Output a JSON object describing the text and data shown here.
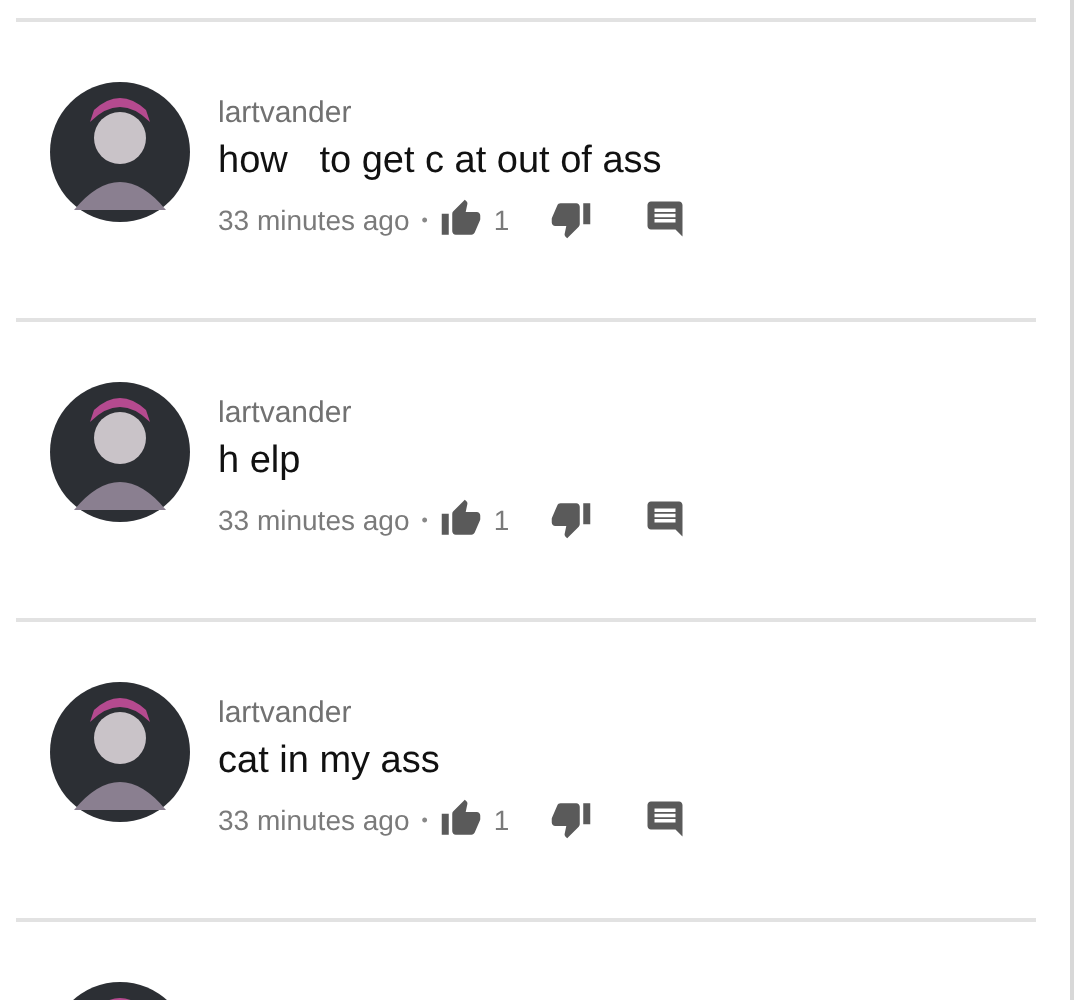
{
  "comments": [
    {
      "kind": "comment",
      "author": "lartvander",
      "text": "how   to get c at out of ass",
      "time": "33 minutes ago",
      "separator": "•",
      "likes": "1"
    },
    {
      "kind": "comment",
      "author": "lartvander",
      "text": "h elp",
      "time": "33 minutes ago",
      "separator": "•",
      "likes": "1"
    },
    {
      "kind": "comment",
      "author": "lartvander",
      "text": "cat in my ass",
      "time": "33 minutes ago",
      "separator": "•",
      "likes": "1"
    },
    {
      "kind": "cut_off"
    }
  ]
}
